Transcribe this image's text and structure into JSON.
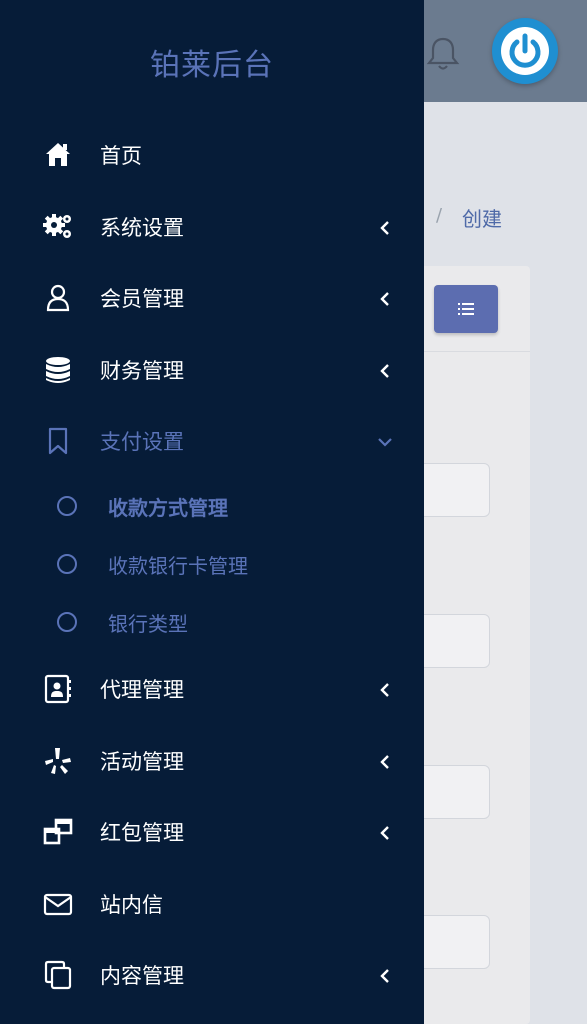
{
  "app": {
    "brand": "铂莱后台"
  },
  "header": {
    "bell_icon": "bell-icon",
    "power_icon": "power-icon",
    "accent": "#1f8fd1"
  },
  "breadcrumb": {
    "separator": "/",
    "current": "创建"
  },
  "menu": [
    {
      "label": "首页",
      "icon": "home-icon",
      "has_arrow": false
    },
    {
      "label": "系统设置",
      "icon": "gears-icon",
      "has_arrow": true
    },
    {
      "label": "会员管理",
      "icon": "user-icon",
      "has_arrow": true
    },
    {
      "label": "财务管理",
      "icon": "database-icon",
      "has_arrow": true
    },
    {
      "label": "支付设置",
      "icon": "bookmark-icon",
      "has_arrow": true,
      "expanded": true,
      "children": [
        {
          "label": "收款方式管理",
          "active": true
        },
        {
          "label": "收款银行卡管理"
        },
        {
          "label": "银行类型"
        }
      ]
    },
    {
      "label": "代理管理",
      "icon": "contact-card-icon",
      "has_arrow": true
    },
    {
      "label": "活动管理",
      "icon": "yelp-icon",
      "has_arrow": true
    },
    {
      "label": "红包管理",
      "icon": "clone-windows-icon",
      "has_arrow": true
    },
    {
      "label": "站内信",
      "icon": "envelope-icon",
      "has_arrow": false
    },
    {
      "label": "内容管理",
      "icon": "copy-icon",
      "has_arrow": true
    }
  ],
  "colors": {
    "drawer_bg": "#061c38",
    "highlight": "#5a73b8",
    "text": "#ffffff"
  }
}
